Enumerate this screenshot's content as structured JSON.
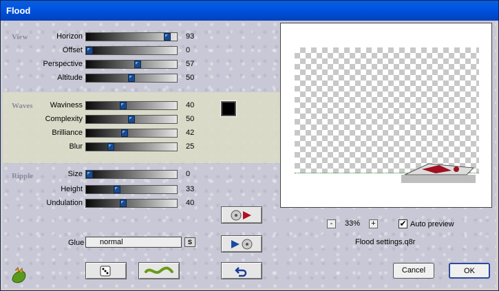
{
  "window": {
    "title": "Flood"
  },
  "sections": {
    "view": "View",
    "waves": "Waves",
    "ripple": "Ripple"
  },
  "sliders": [
    {
      "label": "Horizon",
      "value": "93",
      "fraction": 0.93
    },
    {
      "label": "Offset",
      "value": "0",
      "fraction": 0.0
    },
    {
      "label": "Perspective",
      "value": "57",
      "fraction": 0.57
    },
    {
      "label": "Altitude",
      "value": "50",
      "fraction": 0.5
    },
    {
      "label": "Waviness",
      "value": "40",
      "fraction": 0.4
    },
    {
      "label": "Complexity",
      "value": "50",
      "fraction": 0.5
    },
    {
      "label": "Brilliance",
      "value": "42",
      "fraction": 0.42
    },
    {
      "label": "Blur",
      "value": "25",
      "fraction": 0.25
    },
    {
      "label": "Size",
      "value": "0",
      "fraction": 0.0
    },
    {
      "label": "Height",
      "value": "33",
      "fraction": 0.33
    },
    {
      "label": "Undulation",
      "value": "40",
      "fraction": 0.4
    }
  ],
  "glue": {
    "label": "Glue",
    "value": "normal",
    "button": "S"
  },
  "color": {
    "wave_color": "#000000"
  },
  "preview": {
    "zoom": "33%",
    "minus": "-",
    "plus": "+",
    "auto_preview_label": "Auto preview",
    "auto_preview_checked": true,
    "settings_file": "Flood settings.q8r"
  },
  "buttons": {
    "cancel": "Cancel",
    "ok": "OK"
  },
  "icons": [
    "dice-icon",
    "wave-icon",
    "preset-load-icon",
    "preset-save-icon",
    "undo-icon",
    "app-logo-icon"
  ]
}
